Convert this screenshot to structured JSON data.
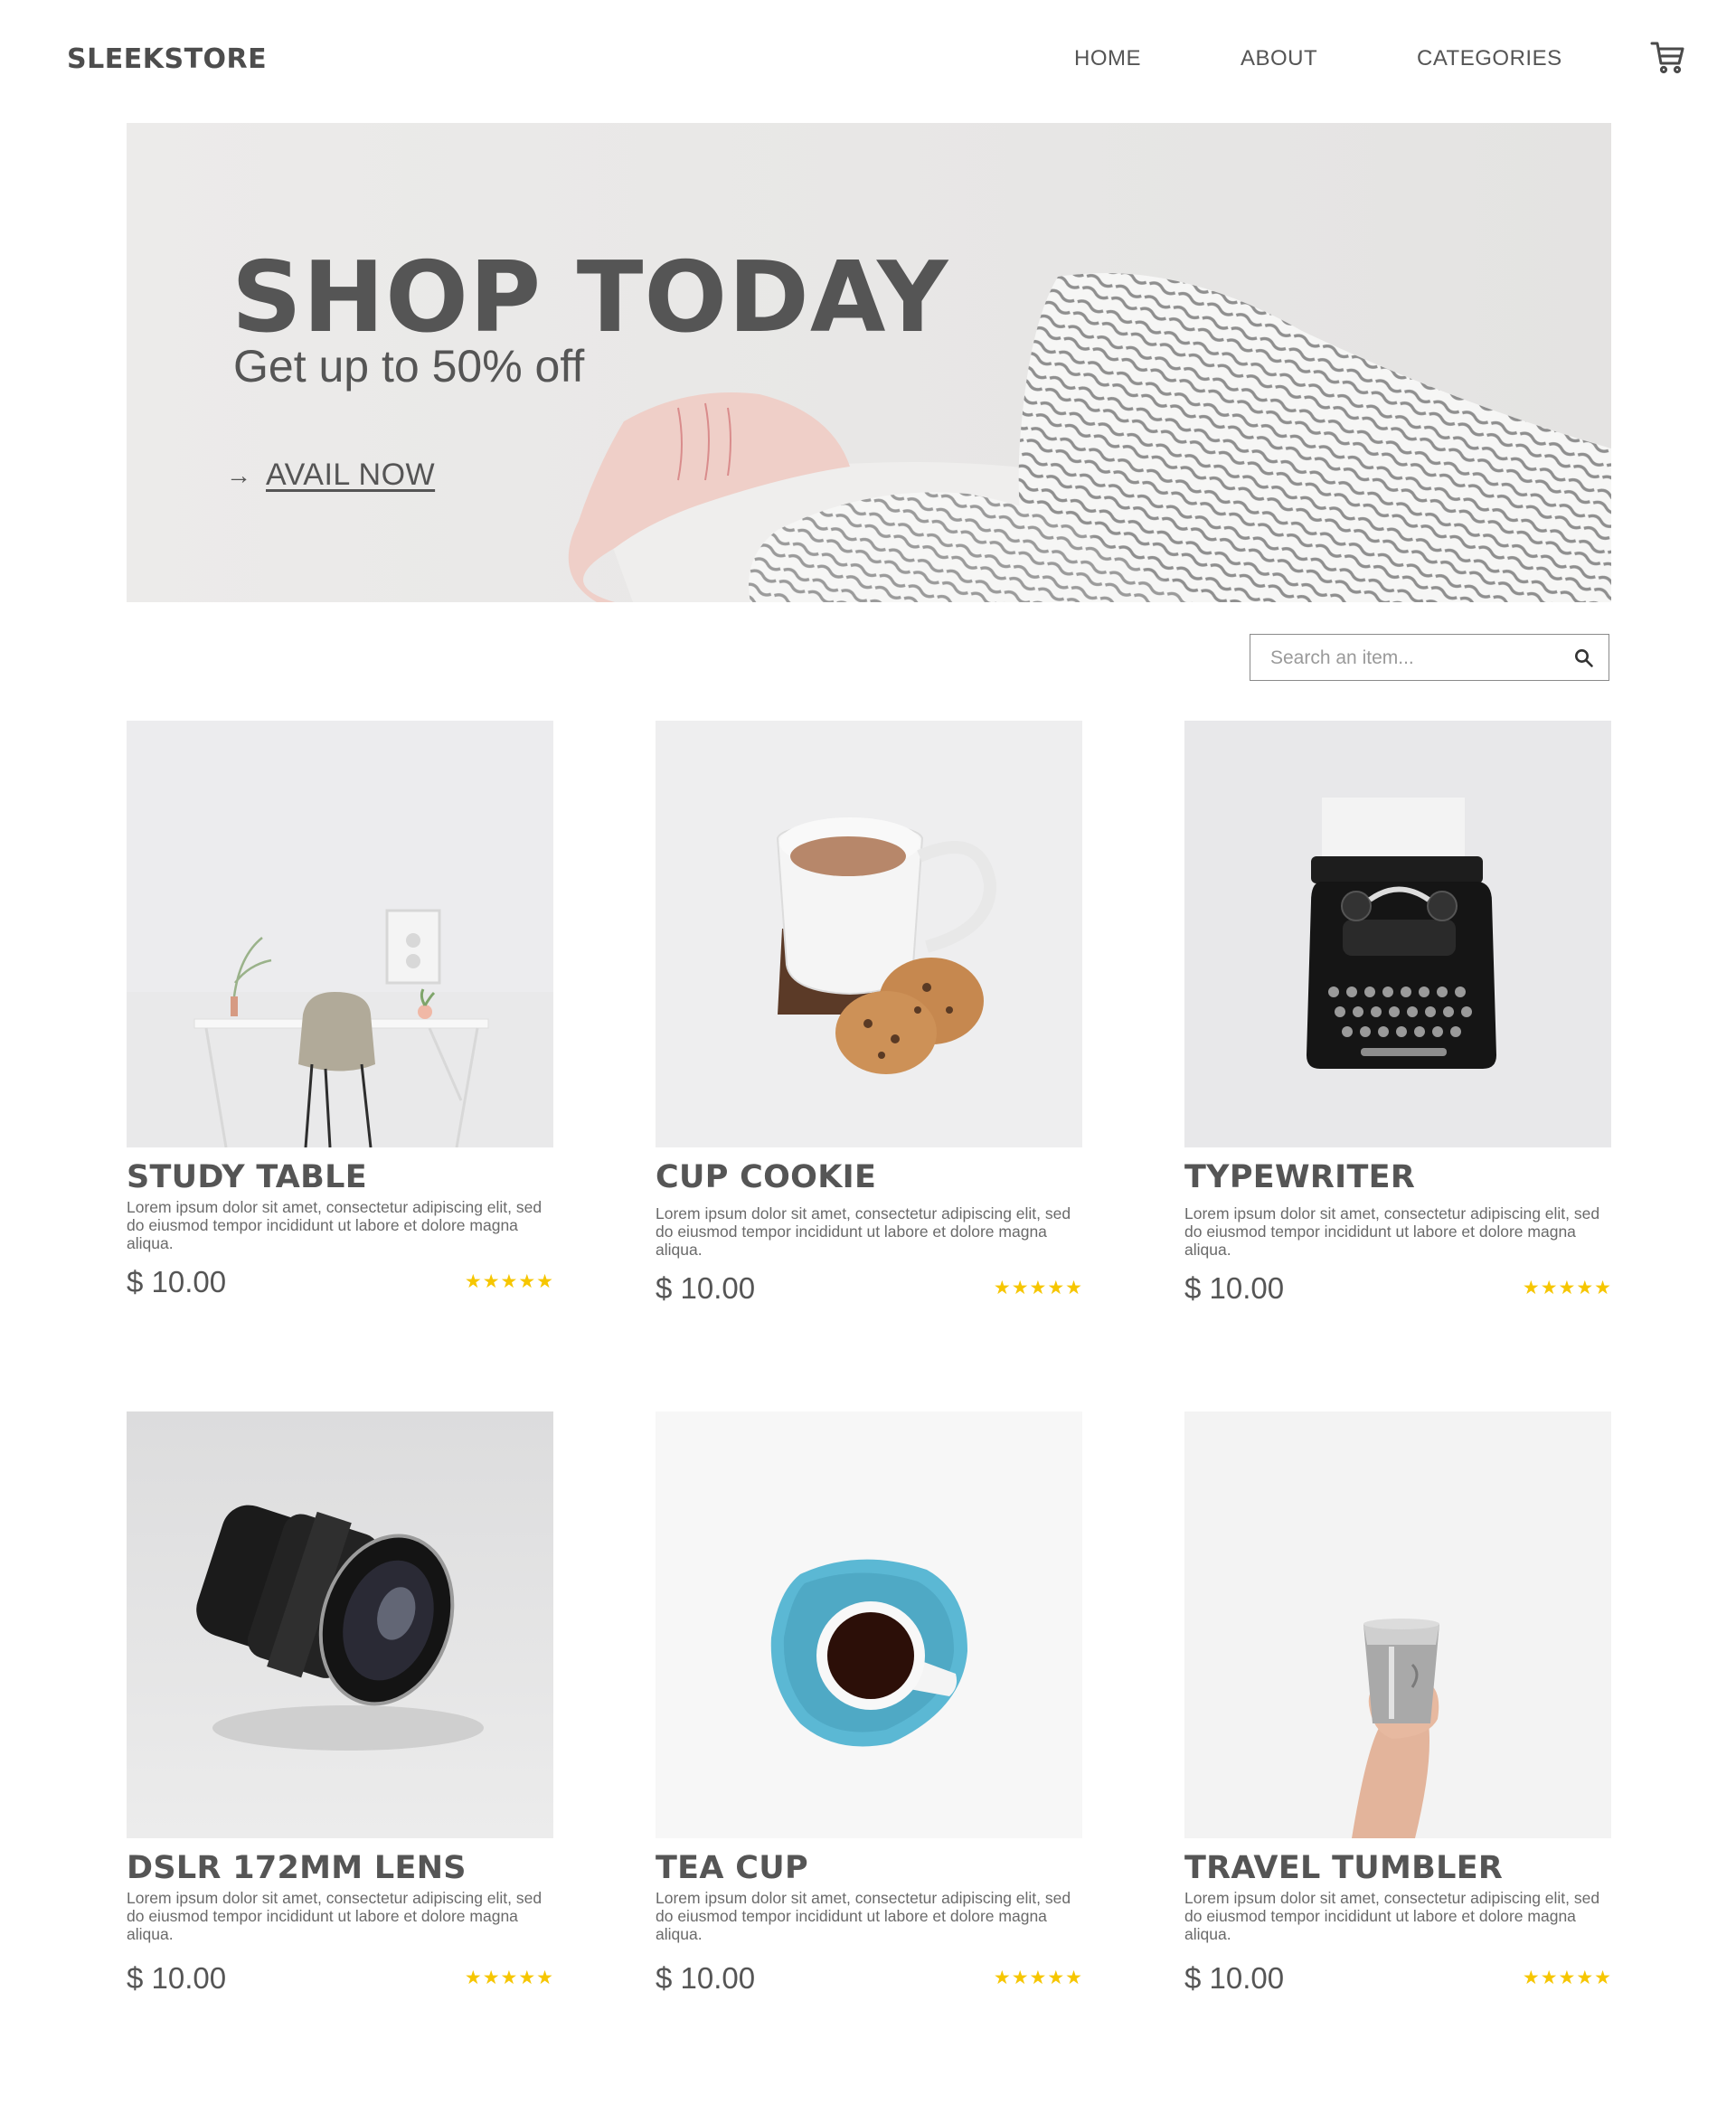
{
  "brand": "SLEEKSTORE",
  "nav": {
    "home": "HOME",
    "about": "ABOUT",
    "categories": "CATEGORIES"
  },
  "icons": {
    "cart": "cart-icon",
    "search": "search-icon",
    "arrow": "arrow-right-icon",
    "star": "star-icon"
  },
  "hero": {
    "title": "SHOP TODAY",
    "subtitle": "Get up to 50% off",
    "cta": "AVAIL NOW",
    "arrow": "→"
  },
  "search": {
    "placeholder": "Search an item..."
  },
  "colors": {
    "text": "#555555",
    "star": "#f6c600",
    "hero_bg": "#ebeaea"
  },
  "products": [
    {
      "name": "STUDY TABLE",
      "description": "Lorem ipsum dolor sit amet, consectetur adipiscing elit, sed do eiusmod tempor incididunt ut labore et dolore magna aliqua.",
      "price": "$ 10.00",
      "rating": 5
    },
    {
      "name": "CUP COOKIE",
      "description": "Lorem ipsum dolor sit amet, consectetur adipiscing elit, sed do eiusmod tempor incididunt ut labore et dolore magna aliqua.",
      "price": "$ 10.00",
      "rating": 5
    },
    {
      "name": "TYPEWRITER",
      "description": "Lorem ipsum dolor sit amet, consectetur adipiscing elit, sed do eiusmod tempor incididunt ut labore et dolore magna aliqua.",
      "price": "$ 10.00",
      "rating": 5
    },
    {
      "name": "DSLR 172MM LENS",
      "description": "Lorem ipsum dolor sit amet, consectetur adipiscing elit, sed do eiusmod tempor incididunt ut labore et dolore magna aliqua.",
      "price": "$ 10.00",
      "rating": 5
    },
    {
      "name": "TEA CUP",
      "description": "Lorem ipsum dolor sit amet, consectetur adipiscing elit, sed do eiusmod tempor incididunt ut labore et dolore magna aliqua.",
      "price": "$ 10.00",
      "rating": 5
    },
    {
      "name": "TRAVEL TUMBLER",
      "description": "Lorem ipsum dolor sit amet, consectetur adipiscing elit, sed do eiusmod tempor incididunt ut labore et dolore magna aliqua.",
      "price": "$ 10.00",
      "rating": 5
    }
  ]
}
